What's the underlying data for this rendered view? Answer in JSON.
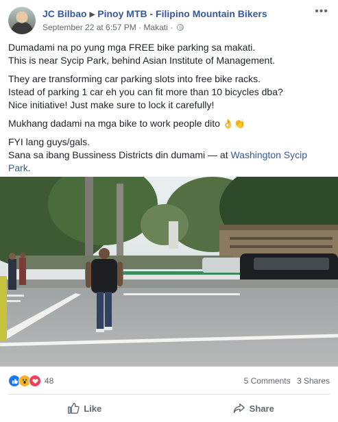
{
  "header": {
    "author": "JC Bilbao",
    "group": "Pinoy MTB - Filipino Mountain Bikers",
    "timestamp": "September 22 at 6:57 PM",
    "location": "Makati",
    "separator": "·"
  },
  "post": {
    "p1": [
      "Dumadami na po yung mga FREE bike parking sa makati.",
      "This is near Sycip Park, behind Asian Institute of Management."
    ],
    "p2": [
      "They are transforming car parking slots into free bike racks.",
      "Istead of parking 1 car eh you can fit more than 10 bicycles dba?",
      "Nice initiative! Just make sure to lock it carefully!"
    ],
    "p3": "Mukhang dadami na mga bike to work people dito",
    "p3_emoji": "👌👏",
    "p4_line1": "FYI lang guys/gals.",
    "p4_line2": "Sana sa ibang Bussiness Districts din dumami — at ",
    "p4_link_a": "Washington Sycip",
    "p4_link_b": "Park",
    "p4_end": "."
  },
  "reactions": {
    "count": "48",
    "icons": [
      "like-icon",
      "wow-icon",
      "love-icon"
    ]
  },
  "stats": {
    "comments": "5 Comments",
    "shares": "3 Shares"
  },
  "actions": {
    "like": "Like",
    "share": "Share"
  },
  "colors": {
    "link": "#365899",
    "muted": "#606770",
    "like_blue": "#1877f2"
  }
}
